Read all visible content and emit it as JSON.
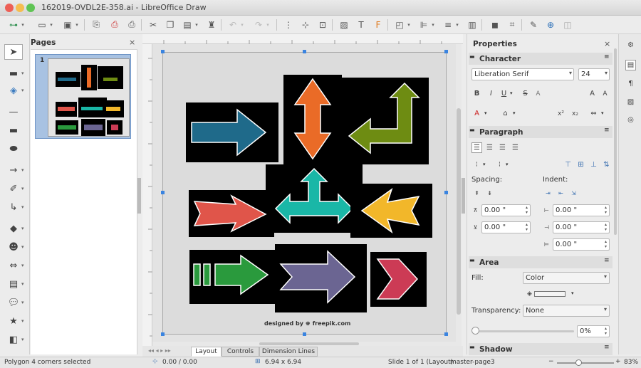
{
  "window": {
    "title": "162019-OVDL2E-358.ai - LibreOffice Draw"
  },
  "pages_panel": {
    "title": "Pages",
    "close": "×",
    "page_number": "1"
  },
  "properties": {
    "title": "Properties",
    "close": "×",
    "character": {
      "header": "Character",
      "font_name": "Liberation Serif",
      "font_size": "24",
      "bold": "B",
      "italic": "I",
      "underline": "U",
      "strike": "S",
      "grow": "A",
      "shrink": "A"
    },
    "paragraph": {
      "header": "Paragraph",
      "spacing_label": "Spacing:",
      "indent_label": "Indent:",
      "above": "0.00 \"",
      "below": "0.00 \"",
      "before": "0.00 \"",
      "after": "0.00 \"",
      "first": "0.00 \""
    },
    "area": {
      "header": "Area",
      "fill_label": "Fill:",
      "fill_value": "Color",
      "transparency_label": "Transparency:",
      "transparency_value": "None",
      "transparency_percent": "0%"
    },
    "shadow": {
      "header": "Shadow"
    }
  },
  "canvas": {
    "credit": "designed by ♚ freepik.com"
  },
  "tabs": [
    "Layout",
    "Controls",
    "Dimension Lines"
  ],
  "status": {
    "selection": "Polygon 4 corners selected",
    "position": "0.00 / 0.00",
    "size": "6.94 x 6.94",
    "slide": "Slide 1 of 1 (Layout)",
    "master": "master-page3",
    "zoom": "83%"
  },
  "colors": {
    "blue": "#1f6a8a",
    "orange": "#ea6b27",
    "olive": "#6e8c12",
    "red": "#e0554a",
    "teal": "#1ab7a7",
    "yellow": "#f2b72a",
    "green": "#2a9a3d",
    "purple": "#6b6592",
    "pink": "#cc3b55"
  }
}
